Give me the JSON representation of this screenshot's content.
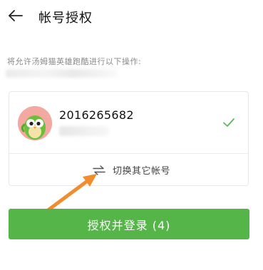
{
  "header": {
    "title": "帐号授权",
    "back_icon": "arrow-left-icon"
  },
  "description": {
    "text": "将允许汤姆猫英雄跑酷进行以下操作:"
  },
  "account": {
    "id": "2016265682",
    "selected": true,
    "check_icon": "checkmark-icon",
    "avatar_icon": "bird-avatar"
  },
  "switch_account": {
    "label": "切换其它帐号",
    "icon": "swap-arrows-icon"
  },
  "primary_button": {
    "label": "授权并登录 (4)"
  },
  "colors": {
    "primary": "#55b548",
    "check": "#5cb85c",
    "annotation_arrow": "#f28c2c"
  }
}
